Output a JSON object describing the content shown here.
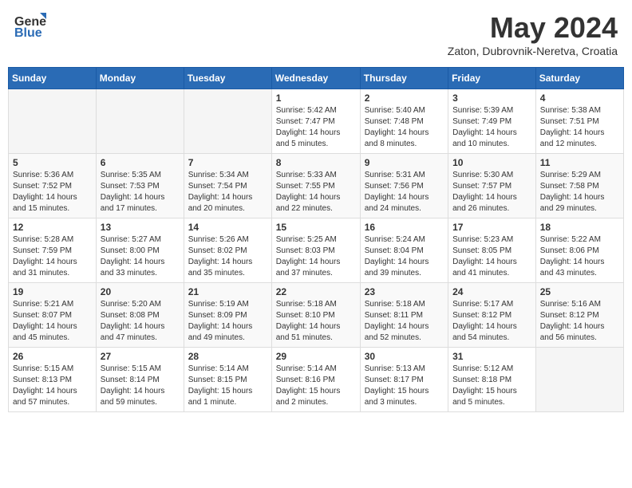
{
  "header": {
    "logo_general": "General",
    "logo_blue": "Blue",
    "title": "May 2024",
    "location": "Zaton, Dubrovnik-Neretva, Croatia"
  },
  "weekdays": [
    "Sunday",
    "Monday",
    "Tuesday",
    "Wednesday",
    "Thursday",
    "Friday",
    "Saturday"
  ],
  "weeks": [
    [
      {
        "day": "",
        "info": ""
      },
      {
        "day": "",
        "info": ""
      },
      {
        "day": "",
        "info": ""
      },
      {
        "day": "1",
        "info": "Sunrise: 5:42 AM\nSunset: 7:47 PM\nDaylight: 14 hours\nand 5 minutes."
      },
      {
        "day": "2",
        "info": "Sunrise: 5:40 AM\nSunset: 7:48 PM\nDaylight: 14 hours\nand 8 minutes."
      },
      {
        "day": "3",
        "info": "Sunrise: 5:39 AM\nSunset: 7:49 PM\nDaylight: 14 hours\nand 10 minutes."
      },
      {
        "day": "4",
        "info": "Sunrise: 5:38 AM\nSunset: 7:51 PM\nDaylight: 14 hours\nand 12 minutes."
      }
    ],
    [
      {
        "day": "5",
        "info": "Sunrise: 5:36 AM\nSunset: 7:52 PM\nDaylight: 14 hours\nand 15 minutes."
      },
      {
        "day": "6",
        "info": "Sunrise: 5:35 AM\nSunset: 7:53 PM\nDaylight: 14 hours\nand 17 minutes."
      },
      {
        "day": "7",
        "info": "Sunrise: 5:34 AM\nSunset: 7:54 PM\nDaylight: 14 hours\nand 20 minutes."
      },
      {
        "day": "8",
        "info": "Sunrise: 5:33 AM\nSunset: 7:55 PM\nDaylight: 14 hours\nand 22 minutes."
      },
      {
        "day": "9",
        "info": "Sunrise: 5:31 AM\nSunset: 7:56 PM\nDaylight: 14 hours\nand 24 minutes."
      },
      {
        "day": "10",
        "info": "Sunrise: 5:30 AM\nSunset: 7:57 PM\nDaylight: 14 hours\nand 26 minutes."
      },
      {
        "day": "11",
        "info": "Sunrise: 5:29 AM\nSunset: 7:58 PM\nDaylight: 14 hours\nand 29 minutes."
      }
    ],
    [
      {
        "day": "12",
        "info": "Sunrise: 5:28 AM\nSunset: 7:59 PM\nDaylight: 14 hours\nand 31 minutes."
      },
      {
        "day": "13",
        "info": "Sunrise: 5:27 AM\nSunset: 8:00 PM\nDaylight: 14 hours\nand 33 minutes."
      },
      {
        "day": "14",
        "info": "Sunrise: 5:26 AM\nSunset: 8:02 PM\nDaylight: 14 hours\nand 35 minutes."
      },
      {
        "day": "15",
        "info": "Sunrise: 5:25 AM\nSunset: 8:03 PM\nDaylight: 14 hours\nand 37 minutes."
      },
      {
        "day": "16",
        "info": "Sunrise: 5:24 AM\nSunset: 8:04 PM\nDaylight: 14 hours\nand 39 minutes."
      },
      {
        "day": "17",
        "info": "Sunrise: 5:23 AM\nSunset: 8:05 PM\nDaylight: 14 hours\nand 41 minutes."
      },
      {
        "day": "18",
        "info": "Sunrise: 5:22 AM\nSunset: 8:06 PM\nDaylight: 14 hours\nand 43 minutes."
      }
    ],
    [
      {
        "day": "19",
        "info": "Sunrise: 5:21 AM\nSunset: 8:07 PM\nDaylight: 14 hours\nand 45 minutes."
      },
      {
        "day": "20",
        "info": "Sunrise: 5:20 AM\nSunset: 8:08 PM\nDaylight: 14 hours\nand 47 minutes."
      },
      {
        "day": "21",
        "info": "Sunrise: 5:19 AM\nSunset: 8:09 PM\nDaylight: 14 hours\nand 49 minutes."
      },
      {
        "day": "22",
        "info": "Sunrise: 5:18 AM\nSunset: 8:10 PM\nDaylight: 14 hours\nand 51 minutes."
      },
      {
        "day": "23",
        "info": "Sunrise: 5:18 AM\nSunset: 8:11 PM\nDaylight: 14 hours\nand 52 minutes."
      },
      {
        "day": "24",
        "info": "Sunrise: 5:17 AM\nSunset: 8:12 PM\nDaylight: 14 hours\nand 54 minutes."
      },
      {
        "day": "25",
        "info": "Sunrise: 5:16 AM\nSunset: 8:12 PM\nDaylight: 14 hours\nand 56 minutes."
      }
    ],
    [
      {
        "day": "26",
        "info": "Sunrise: 5:15 AM\nSunset: 8:13 PM\nDaylight: 14 hours\nand 57 minutes."
      },
      {
        "day": "27",
        "info": "Sunrise: 5:15 AM\nSunset: 8:14 PM\nDaylight: 14 hours\nand 59 minutes."
      },
      {
        "day": "28",
        "info": "Sunrise: 5:14 AM\nSunset: 8:15 PM\nDaylight: 15 hours\nand 1 minute."
      },
      {
        "day": "29",
        "info": "Sunrise: 5:14 AM\nSunset: 8:16 PM\nDaylight: 15 hours\nand 2 minutes."
      },
      {
        "day": "30",
        "info": "Sunrise: 5:13 AM\nSunset: 8:17 PM\nDaylight: 15 hours\nand 3 minutes."
      },
      {
        "day": "31",
        "info": "Sunrise: 5:12 AM\nSunset: 8:18 PM\nDaylight: 15 hours\nand 5 minutes."
      },
      {
        "day": "",
        "info": ""
      }
    ]
  ]
}
